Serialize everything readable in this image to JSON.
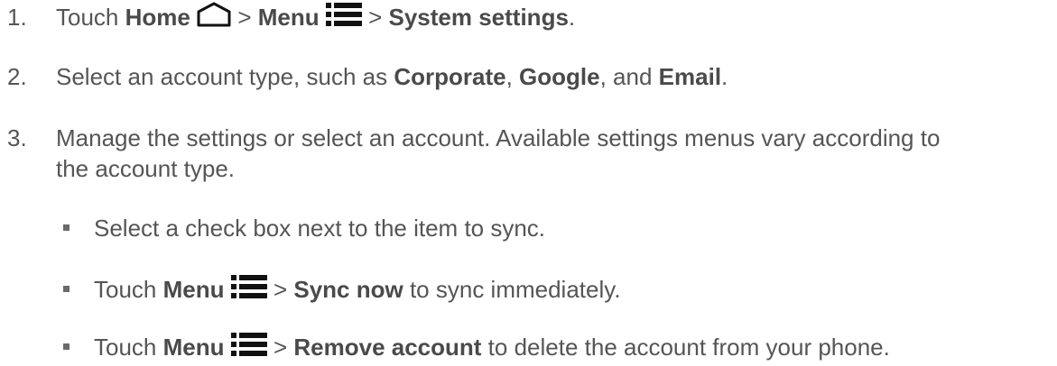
{
  "steps": [
    {
      "num": "1.",
      "pre": "Touch ",
      "b1": "Home",
      "sep1": " > ",
      "b2": "Menu",
      "sep2": " > ",
      "b3": "System settings",
      "end": "."
    },
    {
      "num": "2.",
      "pre": "Select an account type, such as ",
      "b1": "Corporate",
      "c1": ", ",
      "b2": "Google",
      "c2": ", and ",
      "b3": "Email",
      "end": "."
    },
    {
      "num": "3.",
      "line1": "Manage the settings or select an account. Available settings menus vary according to",
      "line2": "the account type."
    }
  ],
  "bullets": [
    {
      "text": "Select a check box next to the item to sync."
    },
    {
      "pre": "Touch ",
      "b1": "Menu",
      "sep": " > ",
      "b2": "Sync now",
      "post": " to sync immediately."
    },
    {
      "pre": "Touch ",
      "b1": "Menu",
      "sep": " > ",
      "b2": "Remove account",
      "post": " to delete the account from your phone."
    }
  ],
  "icons": {
    "home": "home-outline-icon",
    "menu": "menu-icon"
  }
}
